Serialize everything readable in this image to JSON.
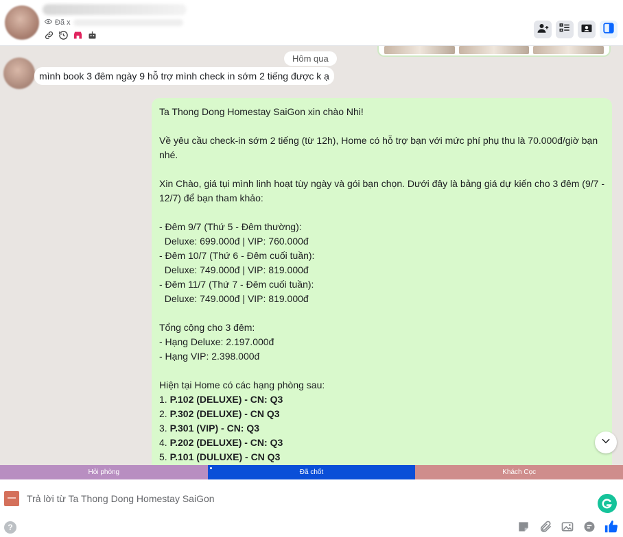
{
  "header": {
    "status_text": "Đã x",
    "actions": [
      "add-person-icon",
      "checklist-icon",
      "contact-card-icon",
      "sidebar-panel-icon"
    ]
  },
  "chat": {
    "date_separator": "Hôm qua",
    "incoming_message": "mình book 3 đêm ngày 9 hỗ trợ mình check in sớm 2 tiếng được k ạ",
    "outgoing_lines": [
      "Ta Thong Dong Homestay SaiGon xin chào Nhi!",
      "",
      "Về yêu cầu check-in sớm 2 tiếng (từ 12h), Home có hỗ trợ bạn với mức phí phụ thu là 70.000đ/giờ bạn",
      "nhé.",
      "",
      "Xin Chào, giá tụi mình linh hoạt tùy ngày và gói bạn chọn. Dưới đây là bảng giá dự kiến cho 3 đêm (9/7 -",
      "12/7) để bạn tham khảo:",
      "",
      "- Đêm 9/7 (Thứ 5 - Đêm thường):",
      "  Deluxe: 699.000đ | VIP: 760.000đ",
      "- Đêm 10/7 (Thứ 6 - Đêm cuối tuần):",
      "  Deluxe: 749.000đ | VIP: 819.000đ",
      "- Đêm 11/7 (Thứ 7 - Đêm cuối tuần):",
      "  Deluxe: 749.000đ | VIP: 819.000đ",
      "",
      "Tổng cộng cho 3 đêm:",
      "- Hạng Deluxe: 2.197.000đ",
      "- Hạng VIP: 2.398.000đ",
      "",
      "Hiện tại Home có các hạng phòng sau:"
    ],
    "room_list": [
      {
        "num": "1. ",
        "name": "P.102 (DELUXE) - CN: Q3"
      },
      {
        "num": "2. ",
        "name": "P.302 (DELUXE) - CN Q3"
      },
      {
        "num": "3. ",
        "name": "P.301 (VIP) - CN: Q3"
      },
      {
        "num": "4. ",
        "name": "P.202 (DELUXE) - CN: Q3"
      },
      {
        "num": "5. ",
        "name": "P.101 (DULUXE) - CN Q3"
      }
    ]
  },
  "tags": [
    "Hỏi phòng",
    "Đã chốt",
    "Khách Cọc"
  ],
  "tag_colors": [
    "#b88ec1",
    "#0a4fd8",
    "#cf8d8c"
  ],
  "composer": {
    "placeholder": "Trả lời từ Ta Thong Dong Homestay SaiGon",
    "help_label": "?",
    "tools": [
      "sticker-icon",
      "attachment-icon",
      "image-icon",
      "saved-reply-icon",
      "like-icon"
    ]
  },
  "colors": {
    "chat_background": "#e9e5e2",
    "outgoing_bubble": "#d9f9cc",
    "accent": "#0a4fd8"
  }
}
